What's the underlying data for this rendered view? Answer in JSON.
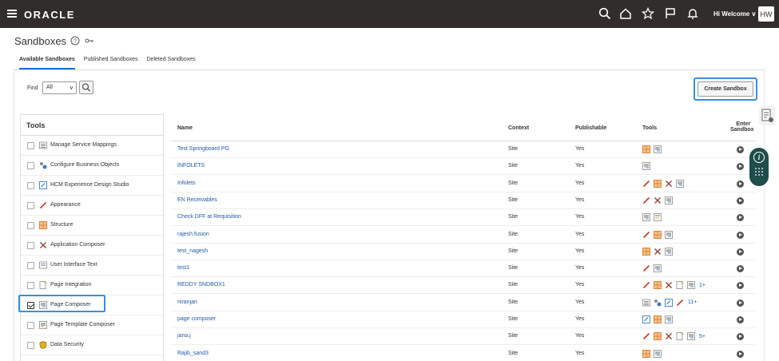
{
  "topbar": {
    "logo": "ORACLE",
    "welcome": "Hi Welcome",
    "avatar_initials": "HW"
  },
  "header": {
    "title": "Sandboxes"
  },
  "tabs": [
    {
      "label": "Available Sandboxes",
      "active": true
    },
    {
      "label": "Published Sandboxes",
      "active": false
    },
    {
      "label": "Deleted Sandboxes",
      "active": false
    }
  ],
  "find": {
    "label": "Find",
    "selected": "All"
  },
  "create_button": "Create Sandbox",
  "tools_panel": {
    "title": "Tools",
    "items": [
      {
        "label": "Manage Service Mappings",
        "icon": "list-icon",
        "checked": false
      },
      {
        "label": "Configure Business Objects",
        "icon": "objects-icon",
        "checked": false
      },
      {
        "label": "HCM Experience Design Studio",
        "icon": "design-studio-icon",
        "checked": false
      },
      {
        "label": "Appearance",
        "icon": "brush-icon",
        "checked": false
      },
      {
        "label": "Structure",
        "icon": "structure-icon",
        "checked": false
      },
      {
        "label": "Application Composer",
        "icon": "tools-icon",
        "checked": false
      },
      {
        "label": "User Interface Text",
        "icon": "text-icon",
        "checked": false
      },
      {
        "label": "Page Integration",
        "icon": "integration-icon",
        "checked": false
      },
      {
        "label": "Page Composer",
        "icon": "composer-icon",
        "checked": true
      },
      {
        "label": "Page Template Composer",
        "icon": "template-icon",
        "checked": false
      },
      {
        "label": "Data Security",
        "icon": "shield-icon",
        "checked": false
      }
    ]
  },
  "table": {
    "headers": {
      "name": "Name",
      "context": "Context",
      "publishable": "Publishable",
      "tools": "Tools",
      "enter_line1": "Enter",
      "enter_line2": "Sandbox"
    },
    "rows": [
      {
        "name": "Test Springboard PG",
        "context": "Site",
        "publishable": "Yes",
        "tools": [
          "structure",
          "composer"
        ],
        "more": ""
      },
      {
        "name": "INFOLETS",
        "context": "Site",
        "publishable": "Yes",
        "tools": [
          "composer"
        ],
        "more": ""
      },
      {
        "name": "Infolets",
        "context": "Site",
        "publishable": "Yes",
        "tools": [
          "brush",
          "structure",
          "appcomposer",
          "composer"
        ],
        "more": ""
      },
      {
        "name": "EN Receivables",
        "context": "Site",
        "publishable": "Yes",
        "tools": [
          "brush",
          "appcomposer",
          "composer"
        ],
        "more": ""
      },
      {
        "name": "Check DFF at Requisition",
        "context": "Site",
        "publishable": "Yes",
        "tools": [
          "composer",
          "template"
        ],
        "more": ""
      },
      {
        "name": "rajesh.fusion",
        "context": "Site",
        "publishable": "Yes",
        "tools": [
          "brush",
          "structure",
          "composer"
        ],
        "more": ""
      },
      {
        "name": "test_nagesh",
        "context": "Site",
        "publishable": "Yes",
        "tools": [
          "structure",
          "appcomposer",
          "composer"
        ],
        "more": ""
      },
      {
        "name": "test1",
        "context": "Site",
        "publishable": "Yes",
        "tools": [
          "brush",
          "composer"
        ],
        "more": ""
      },
      {
        "name": "REDDY SNDBOX1",
        "context": "Site",
        "publishable": "Yes",
        "tools": [
          "brush",
          "structure",
          "appcomposer",
          "integration",
          "composer"
        ],
        "more": "1+"
      },
      {
        "name": "niranjan",
        "context": "Site",
        "publishable": "Yes",
        "tools": [
          "list",
          "objects",
          "studio",
          "brush"
        ],
        "more": "11+"
      },
      {
        "name": "page composer",
        "context": "Site",
        "publishable": "Yes",
        "tools": [
          "studio",
          "structure",
          "composer"
        ],
        "more": ""
      },
      {
        "name": "jana.j",
        "context": "Site",
        "publishable": "Yes",
        "tools": [
          "brush",
          "structure",
          "appcomposer",
          "integration",
          "composer"
        ],
        "more": "5+"
      },
      {
        "name": "Rajib_sand3",
        "context": "Site",
        "publishable": "Yes",
        "tools": [
          "structure",
          "composer"
        ],
        "more": ""
      }
    ]
  },
  "colors": {
    "topbar": "#312d2a",
    "link": "#1f5aa6",
    "highlight": "#3a8fd8",
    "assistant": "#1f4e4a"
  }
}
